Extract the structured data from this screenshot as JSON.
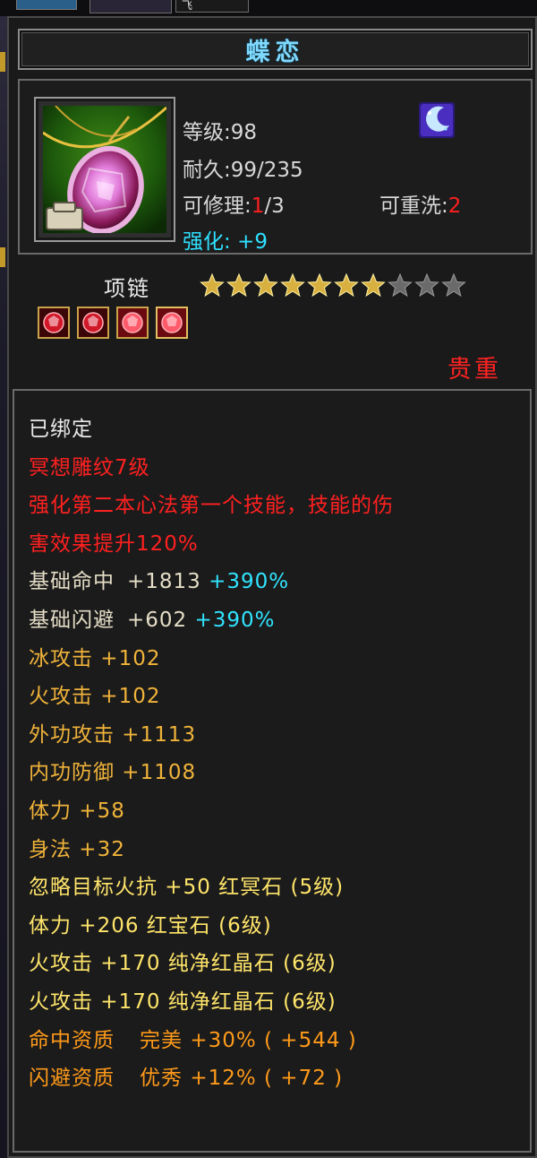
{
  "top_tab_label": "飞",
  "item": {
    "name": "蝶恋",
    "icon": "pendant-necklace-icon",
    "bind_badge_icon": "moon-swirl-badge-icon",
    "level_label": "等级",
    "level_value": ":98",
    "durability_label": "耐久",
    "durability_value": ":99/235",
    "repair_label": "可修理",
    "repair_used": "1",
    "repair_total": "/3",
    "rewash_label": "可重洗",
    "rewash_value": "2",
    "enhance_label": "强化",
    "enhance_value": "+9",
    "type": "项链",
    "stars_total": 10,
    "stars_filled": 7,
    "gems": [
      "red-gem-icon",
      "red-gem-icon",
      "red-gem-icon",
      "red-gem-icon"
    ],
    "rarity": "贵重"
  },
  "attributes": {
    "bound": "已绑定",
    "engraving": "冥想雕纹7级",
    "engraving_desc_1": "强化第二本心法第一个技能，技能的伤",
    "engraving_desc_2": "害效果提升120%",
    "base_hit_label": "基础命中",
    "base_hit_value": "+1813",
    "base_hit_bonus": "+390%",
    "base_dodge_label": "基础闪避",
    "base_dodge_value": "+602",
    "base_dodge_bonus": "+390%",
    "ice_attack": "冰攻击 +102",
    "fire_attack": "火攻击 +102",
    "ext_attack": "外功攻击 +1113",
    "int_defense": "内功防御 +1108",
    "stamina": "体力 +58",
    "agility": "身法 +32",
    "gem_1_stat": "忽略目标火抗 +50",
    "gem_1_name": "红冥石 (5级)",
    "gem_2_stat": "体力 +206",
    "gem_2_name": "红宝石 (6级)",
    "gem_3_stat": "火攻击 +170",
    "gem_3_name": "纯净红晶石 (6级)",
    "gem_4_stat": "火攻击 +170",
    "gem_4_name": "纯净红晶石 (6级)",
    "aptitude_1_label": "命中资质",
    "aptitude_1_grade": "完美",
    "aptitude_1_value": "+30% ( +544 )",
    "aptitude_2_label": "闪避资质",
    "aptitude_2_grade": "优秀",
    "aptitude_2_value": "+12% ( +72 )"
  },
  "colors": {
    "title": "#7fd9ff",
    "red": "#ff2020",
    "cyan": "#30e4ff",
    "gold": "#f0b33a",
    "orange": "#ff9a1a",
    "yellow": "#ffe56a"
  }
}
